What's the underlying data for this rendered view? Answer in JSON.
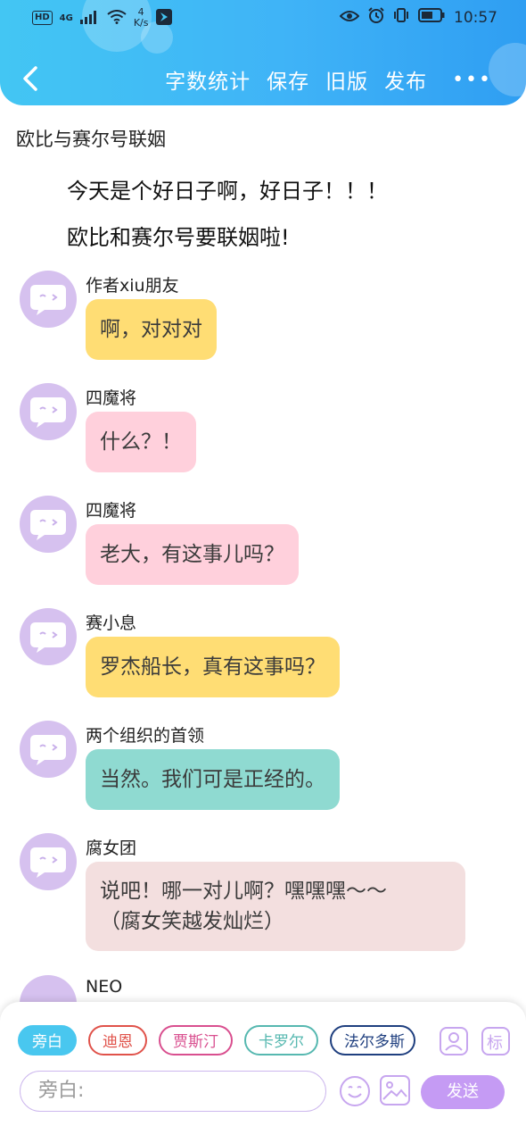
{
  "status_bar": {
    "network_badge": "HD",
    "network_type": "4G",
    "speed_value": "4",
    "speed_unit": "K/s",
    "time": "10:57"
  },
  "nav": {
    "word_count": "字数统计",
    "save": "保存",
    "old_version": "旧版",
    "publish": "发布",
    "more": "•••"
  },
  "story": {
    "title": "欧比与赛尔号联姻",
    "narration": [
      "今天是个好日子啊，好日子！！！",
      "欧比和赛尔号要联姻啦!"
    ]
  },
  "messages": [
    {
      "speaker": "作者xiu朋友",
      "text": "啊，对对对",
      "color": "#ffdd74"
    },
    {
      "speaker": "四魔将",
      "text": "什么？！",
      "color": "#ffd0dc"
    },
    {
      "speaker": "四魔将",
      "text": "老大，有这事儿吗？",
      "color": "#ffd0dc"
    },
    {
      "speaker": "赛小息",
      "text": "罗杰船长，真有这事吗？",
      "color": "#ffdd74"
    },
    {
      "speaker": "两个组织的首领",
      "text": "当然。我们可是正经的。",
      "color": "#8fdad1"
    },
    {
      "speaker": "腐女团",
      "text_line1": "说吧！哪一对儿啊？嘿嘿嘿～～",
      "text_line2": "（腐女笑越发灿烂）",
      "color": "#f3dfdf"
    },
    {
      "speaker": "NEO"
    }
  ],
  "composer": {
    "chips": [
      {
        "label": "旁白",
        "color": "#49c7ef",
        "active": true
      },
      {
        "label": "迪恩",
        "color": "#e0524a"
      },
      {
        "label": "贾斯汀",
        "color": "#d94f8f"
      },
      {
        "label": "卡罗尔",
        "color": "#56b8b0"
      },
      {
        "label": "法尔多斯",
        "color": "#1f3f7f"
      }
    ],
    "tag_label": "标",
    "input_placeholder": "旁白:",
    "send_label": "发送"
  },
  "colors": {
    "header_gradient_start": "#43c6f3",
    "header_gradient_end": "#2f9ef2",
    "avatar": "#d6c1ef",
    "send_button": "#c59bf4"
  }
}
